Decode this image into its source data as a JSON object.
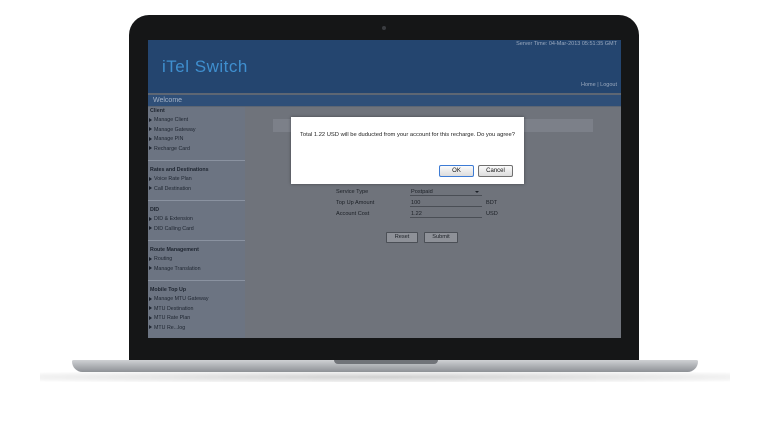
{
  "header": {
    "server_time": "Server Time: 04-Mar-2013 05:51:35 GMT",
    "logo": "iTel Switch",
    "home_link": "Home",
    "separator": "|",
    "logout_link": "Logout"
  },
  "welcome": "Welcome",
  "sidebar": {
    "sections": [
      {
        "title": "Client",
        "items": [
          "Manage Client",
          "Manage Gateway",
          "Manage PIN",
          "Recharge Card"
        ]
      },
      {
        "title": "Rates and Destinations",
        "items": [
          "Voice Rate Plan",
          "Call Destination"
        ]
      },
      {
        "title": "DID",
        "items": [
          "DID & Extension",
          "DID Calling Card"
        ]
      },
      {
        "title": "Route Management",
        "items": [
          "Routing",
          "Manage Translation"
        ]
      },
      {
        "title": "Mobile Top Up",
        "items": [
          "Manage MTU Gateway",
          "MTU Destination",
          "MTU Rate Plan",
          "MTU Re...log"
        ]
      }
    ]
  },
  "form": {
    "service_type_label": "Service Type",
    "service_type_value": "Postpaid",
    "top_up_amount_label": "Top Up Amount",
    "top_up_amount_value": "100",
    "top_up_amount_unit": "BDT",
    "account_cost_label": "Account Cost",
    "account_cost_value": "1.22",
    "account_cost_unit": "USD",
    "reset_label": "Reset",
    "submit_label": "Submit"
  },
  "dialog": {
    "message": "Total 1.22 USD will be duducted from your account for this recharge. Do you agree?",
    "ok_label": "OK",
    "cancel_label": "Cancel"
  }
}
